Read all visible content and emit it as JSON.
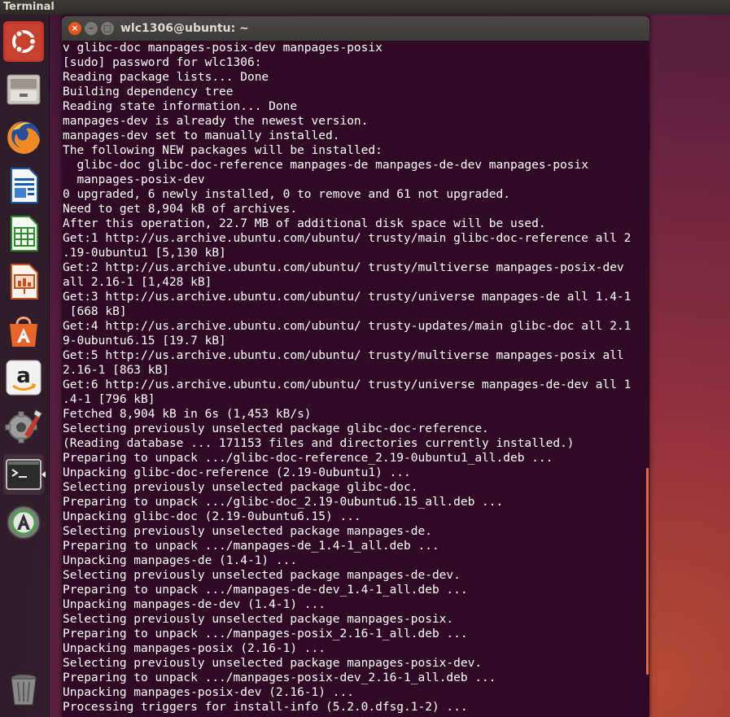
{
  "topbar": {
    "title": "Terminal"
  },
  "launcher": {
    "items": [
      {
        "icon": "ubuntu-dash-icon"
      },
      {
        "icon": "files-icon"
      },
      {
        "icon": "firefox-icon"
      },
      {
        "icon": "libreoffice-writer-icon"
      },
      {
        "icon": "libreoffice-calc-icon"
      },
      {
        "icon": "libreoffice-impress-icon"
      },
      {
        "icon": "software-center-icon"
      },
      {
        "icon": "amazon-icon"
      },
      {
        "icon": "system-settings-icon"
      },
      {
        "icon": "terminal-icon"
      },
      {
        "icon": "software-updater-icon"
      },
      {
        "icon": "trash-icon"
      }
    ]
  },
  "window": {
    "title": "wlc1306@ubuntu: ~",
    "close_glyph": "×",
    "min_glyph": "–",
    "max_glyph": "□"
  },
  "terminal": {
    "lines": [
      "v glibc-doc manpages-posix-dev manpages-posix",
      "[sudo] password for wlc1306:",
      "Reading package lists... Done",
      "Building dependency tree",
      "Reading state information... Done",
      "manpages-dev is already the newest version.",
      "manpages-dev set to manually installed.",
      "The following NEW packages will be installed:",
      "  glibc-doc glibc-doc-reference manpages-de manpages-de-dev manpages-posix",
      "  manpages-posix-dev",
      "0 upgraded, 6 newly installed, 0 to remove and 61 not upgraded.",
      "Need to get 8,904 kB of archives.",
      "After this operation, 22.7 MB of additional disk space will be used.",
      "Get:1 http://us.archive.ubuntu.com/ubuntu/ trusty/main glibc-doc-reference all 2",
      ".19-0ubuntu1 [5,130 kB]",
      "Get:2 http://us.archive.ubuntu.com/ubuntu/ trusty/multiverse manpages-posix-dev",
      "all 2.16-1 [1,428 kB]",
      "Get:3 http://us.archive.ubuntu.com/ubuntu/ trusty/universe manpages-de all 1.4-1",
      " [668 kB]",
      "Get:4 http://us.archive.ubuntu.com/ubuntu/ trusty-updates/main glibc-doc all 2.1",
      "9-0ubuntu6.15 [19.7 kB]",
      "Get:5 http://us.archive.ubuntu.com/ubuntu/ trusty/multiverse manpages-posix all",
      "2.16-1 [863 kB]",
      "Get:6 http://us.archive.ubuntu.com/ubuntu/ trusty/universe manpages-de-dev all 1",
      ".4-1 [796 kB]",
      "Fetched 8,904 kB in 6s (1,453 kB/s)",
      "Selecting previously unselected package glibc-doc-reference.",
      "(Reading database ... 171153 files and directories currently installed.)",
      "Preparing to unpack .../glibc-doc-reference_2.19-0ubuntu1_all.deb ...",
      "Unpacking glibc-doc-reference (2.19-0ubuntu1) ...",
      "Selecting previously unselected package glibc-doc.",
      "Preparing to unpack .../glibc-doc_2.19-0ubuntu6.15_all.deb ...",
      "Unpacking glibc-doc (2.19-0ubuntu6.15) ...",
      "Selecting previously unselected package manpages-de.",
      "Preparing to unpack .../manpages-de_1.4-1_all.deb ...",
      "Unpacking manpages-de (1.4-1) ...",
      "Selecting previously unselected package manpages-de-dev.",
      "Preparing to unpack .../manpages-de-dev_1.4-1_all.deb ...",
      "Unpacking manpages-de-dev (1.4-1) ...",
      "Selecting previously unselected package manpages-posix.",
      "Preparing to unpack .../manpages-posix_2.16-1_all.deb ...",
      "Unpacking manpages-posix (2.16-1) ...",
      "Selecting previously unselected package manpages-posix-dev.",
      "Preparing to unpack .../manpages-posix-dev_2.16-1_all.deb ...",
      "Unpacking manpages-posix-dev (2.16-1) ...",
      "Processing triggers for install-info (5.2.0.dfsg.1-2) ..."
    ]
  },
  "colors": {
    "terminal_bg": "#300a24",
    "terminal_fg": "#ffffff",
    "accent": "#e95420"
  }
}
